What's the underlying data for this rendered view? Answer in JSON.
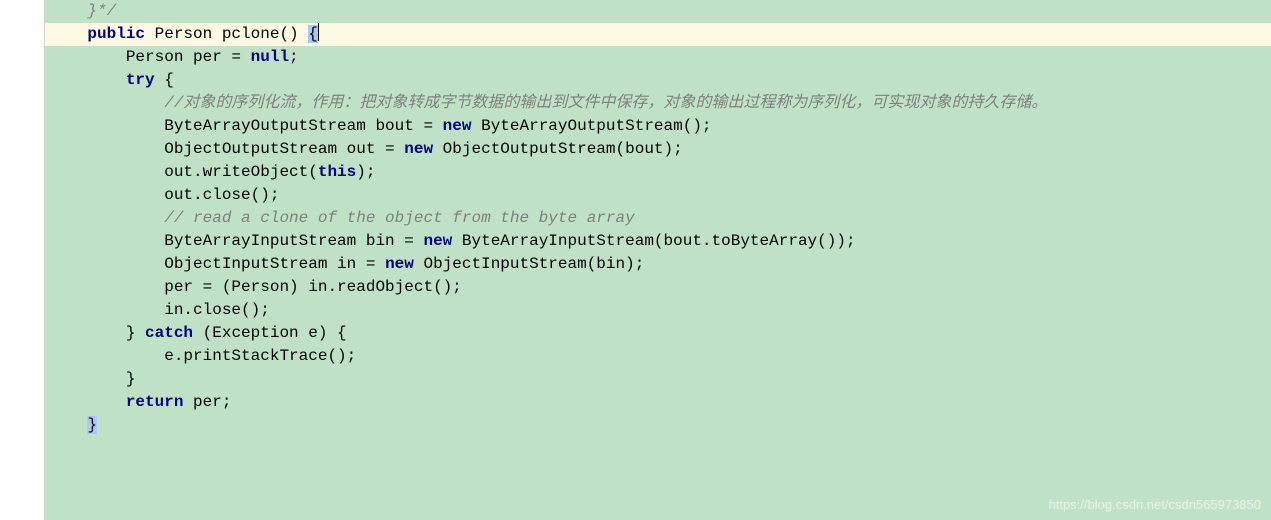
{
  "code": {
    "l0": "    }*/",
    "l1a": "    ",
    "l1_kw1": "public",
    "l1b": " Person pclone() ",
    "l1_brace": "{",
    "l2": "",
    "l3a": "        Person per = ",
    "l3_kw": "null",
    "l3b": ";",
    "l4a": "        ",
    "l4_kw": "try",
    "l4b": " {",
    "l5": "            //对象的序列化流，作用：把对象转成字节数据的输出到文件中保存，对象的输出过程称为序列化，可实现对象的持久存储。",
    "l6a": "            ByteArrayOutputStream bout = ",
    "l6_kw": "new",
    "l6b": " ByteArrayOutputStream();",
    "l7a": "            ObjectOutputStream out = ",
    "l7_kw": "new",
    "l7b": " ObjectOutputStream(bout);",
    "l8a": "            out.writeObject(",
    "l8_kw": "this",
    "l8b": ");",
    "l9": "            out.close();",
    "l10": "",
    "l11": "            // read a clone of the object from the byte array",
    "l12a": "            ByteArrayInputStream bin = ",
    "l12_kw": "new",
    "l12b": " ByteArrayInputStream(bout.toByteArray());",
    "l13a": "            ObjectInputStream in = ",
    "l13_kw": "new",
    "l13b": " ObjectInputStream(bin);",
    "l14": "            per = (Person) in.readObject();",
    "l15": "            in.close();",
    "l16a": "        } ",
    "l16_kw": "catch",
    "l16b": " (Exception e) {",
    "l17": "            e.printStackTrace();",
    "l18": "        }",
    "l19a": "        ",
    "l19_kw": "return",
    "l19b": " per;",
    "l20": "",
    "l21a": "    ",
    "l21_brace": "}"
  },
  "watermark": "https://blog.csdn.net/csdn565973850"
}
